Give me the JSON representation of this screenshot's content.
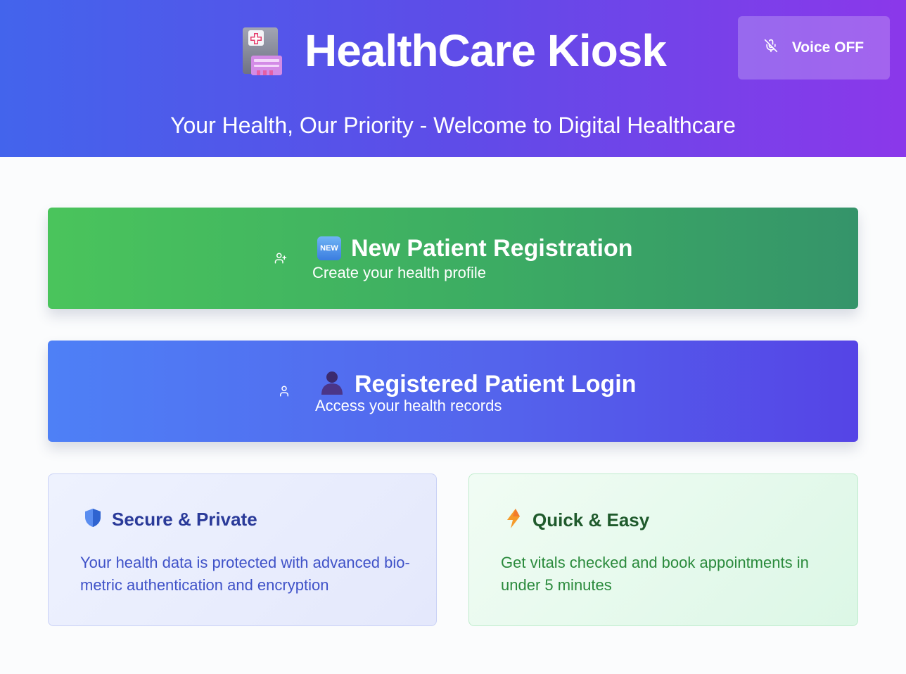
{
  "header": {
    "title": "HealthCare Kiosk",
    "subtitle": "Your Health, Our Priority - Welcome to Digital Healthcare",
    "logo_icon": "medical-kiosk-icon",
    "voice_button": {
      "label": "Voice OFF",
      "icon": "microphone-off-icon"
    }
  },
  "actions": [
    {
      "id": "new-patient",
      "title": "New Patient Registration",
      "description": "Create your health profile",
      "icons": [
        "add-user-icon",
        "new-badge-icon"
      ],
      "badge_text": "NEW"
    },
    {
      "id": "registered-login",
      "title": "Registered Patient Login",
      "description": "Access your health records",
      "icons": [
        "user-icon",
        "person-silhouette-icon"
      ]
    }
  ],
  "info_cards": [
    {
      "id": "secure",
      "title": "Secure & Private",
      "text": "Your health data is protected with advanced bio-metric authentication and encryption",
      "icon": "shield-icon"
    },
    {
      "id": "quick",
      "title": "Quick & Easy",
      "text": "Get vitals checked and book appointments in under 5 minutes",
      "icon": "lightning-icon"
    }
  ],
  "colors": {
    "header_gradient": [
      "#4364ec",
      "#8b38ea"
    ],
    "new_patient_gradient": [
      "#4ac45c",
      "#35946a"
    ],
    "login_gradient": [
      "#4e80f6",
      "#5544e6"
    ],
    "secure_accent": "#2a3a99",
    "quick_accent": "#1f5a2c"
  }
}
